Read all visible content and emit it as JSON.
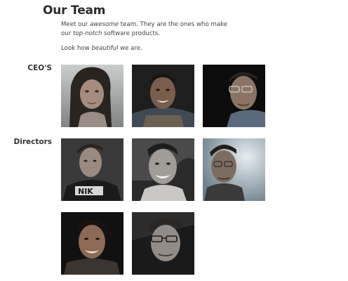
{
  "page": {
    "title": "Our Team",
    "intro": {
      "p1_part1": "Meet our ",
      "p1_em1": "awesome",
      "p1_part2": " team. They are the ones who make our ",
      "p1_em2": "top-notch",
      "p1_part3": " software products.",
      "p2_part1": "Look how ",
      "p2_em": "beautiful",
      "p2_part2": " we are."
    }
  },
  "sections": {
    "ceos": {
      "label": "CEO'S",
      "photos": [
        {
          "name": "ceo-photo-1",
          "tone": "#8a8f8e",
          "bg": "#b8bcbc"
        },
        {
          "name": "ceo-photo-2",
          "tone": "#6b5a4c",
          "bg": "#1c1c1c"
        },
        {
          "name": "ceo-photo-3",
          "tone": "#8a7a6c",
          "bg": "#0e0e0e"
        }
      ]
    },
    "directors": {
      "label": "Directors",
      "photos": [
        {
          "name": "director-photo-1",
          "tone": "#6d6a68",
          "bg": "#3c3c3c"
        },
        {
          "name": "director-photo-2",
          "tone": "#8a8886",
          "bg": "#2b2b2b"
        },
        {
          "name": "director-photo-3",
          "tone": "#7c7068",
          "bg": "#8c9ea8"
        },
        {
          "name": "director-photo-4",
          "tone": "#7a5c4a",
          "bg": "#141414"
        },
        {
          "name": "director-photo-5",
          "tone": "#8f8a86",
          "bg": "#1a1a1a"
        }
      ]
    }
  }
}
